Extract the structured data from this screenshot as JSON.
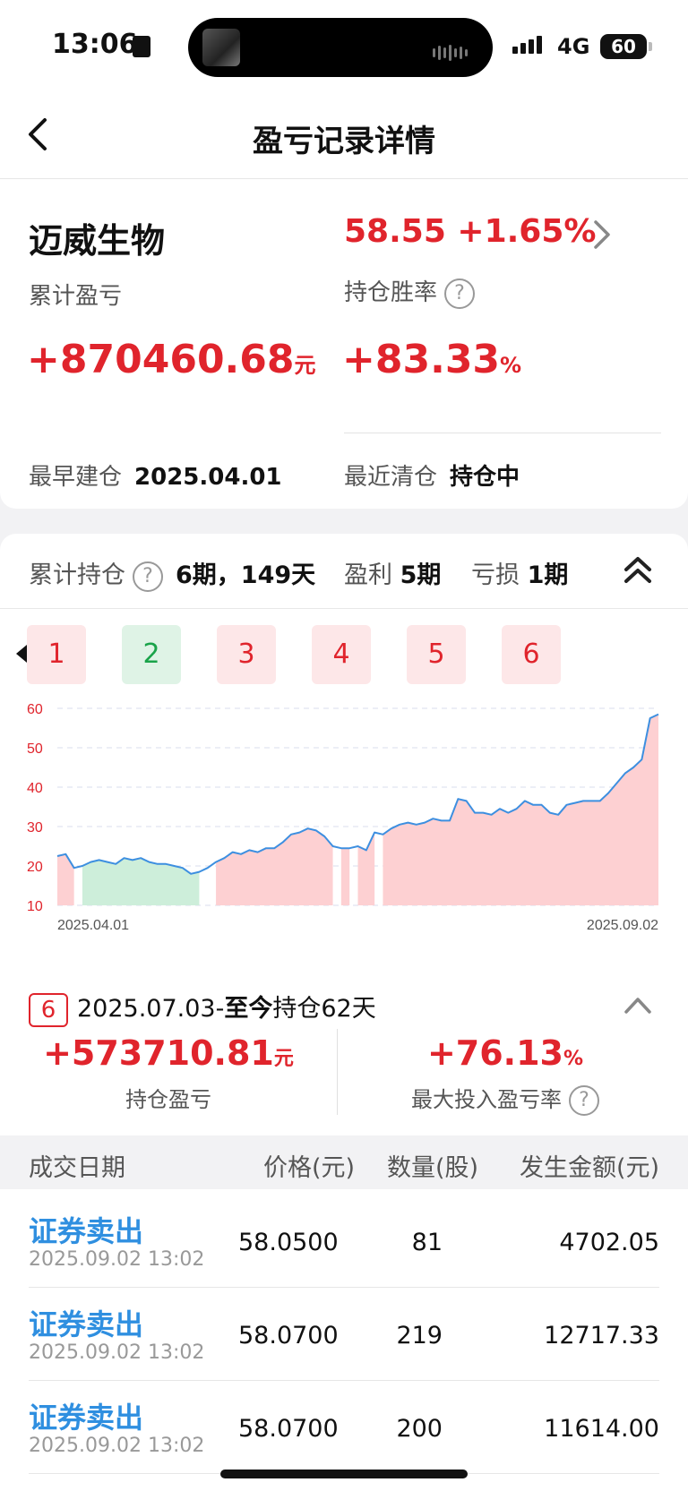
{
  "status_bar": {
    "time": "13:06",
    "network": "4G",
    "battery": "60"
  },
  "nav": {
    "title": "盈亏记录详情"
  },
  "stock": {
    "name": "迈威生物",
    "price_change": "58.55 +1.65%",
    "cumulative_label": "累计盈亏",
    "cumulative_value": "+870460.68",
    "cumulative_unit": "元",
    "winrate_label": "持仓胜率",
    "winrate_value": "+83.33",
    "winrate_unit": "%",
    "first_open_label": "最早建仓",
    "first_open_value": "2025.04.01",
    "last_clear_label": "最近清仓",
    "last_clear_value": "持仓中"
  },
  "holdings_summary": {
    "total_label": "累计持仓",
    "total_value": "6期，149天",
    "profit_label": "盈利",
    "profit_value": "5期",
    "loss_label": "亏损",
    "loss_value": "1期"
  },
  "periods": [
    {
      "label": "1",
      "result": "loss"
    },
    {
      "label": "2",
      "result": "win"
    },
    {
      "label": "3",
      "result": "loss"
    },
    {
      "label": "4",
      "result": "loss"
    },
    {
      "label": "5",
      "result": "loss"
    },
    {
      "label": "6",
      "result": "loss"
    }
  ],
  "chart_data": {
    "type": "area",
    "y_ticks": [
      "60",
      "50",
      "40",
      "30",
      "20",
      "10"
    ],
    "ylim": [
      10,
      60
    ],
    "x_start_label": "2025.04.01",
    "x_end_label": "2025.09.02",
    "grid": true,
    "colors": {
      "line": "#3d8fe0",
      "loss_fill": "#fdd0d2",
      "win_fill": "#cdeeda"
    },
    "price_series": [
      22.5,
      23,
      19.5,
      20,
      21,
      21.5,
      21,
      20.5,
      22,
      21.5,
      22,
      21,
      20.5,
      20.5,
      20,
      19.5,
      18,
      18.5,
      19.5,
      21,
      22,
      23.5,
      23,
      24,
      23.5,
      24.5,
      24.5,
      26,
      28,
      28.5,
      29.5,
      29,
      27.5,
      25,
      24.5,
      24.5,
      25,
      24,
      28.5,
      28,
      29.5,
      30.5,
      31,
      30.5,
      31,
      32,
      31.5,
      31.5,
      37,
      36.5,
      33.5,
      33.5,
      33,
      34.5,
      33.5,
      34.5,
      36.5,
      35.5,
      35.5,
      33.5,
      33,
      35.5,
      36,
      36.5,
      36.5,
      36.5,
      38.5,
      41,
      43.5,
      45,
      47,
      57.5,
      58.5
    ],
    "holding_segments": [
      {
        "period": "1",
        "result": "loss",
        "start": 0,
        "end": 2
      },
      {
        "period": "2",
        "result": "win",
        "start": 3,
        "end": 17
      },
      {
        "period": "3",
        "result": "loss",
        "start": 19,
        "end": 33
      },
      {
        "period": "4",
        "result": "loss",
        "start": 34,
        "end": 35
      },
      {
        "period": "5",
        "result": "loss",
        "start": 36,
        "end": 38
      },
      {
        "period": "6",
        "result": "loss",
        "start": 39,
        "end": 72
      }
    ]
  },
  "current_period": {
    "badge": "6",
    "date_range": "2025.07.03-",
    "to_now": "至今",
    "holding_prefix": "持仓",
    "days": "62天",
    "pnl_value": "+573710.81",
    "pnl_unit": "元",
    "pnl_label": "持仓盈亏",
    "rate_value": "+76.13",
    "rate_unit": "%",
    "rate_label": "最大投入盈亏率"
  },
  "table": {
    "headers": [
      "成交日期",
      "价格(元)",
      "数量(股)",
      "发生金额(元)"
    ],
    "rows": [
      {
        "type": "证券卖出",
        "time": "2025.09.02 13:02",
        "price": "58.0500",
        "qty": "81",
        "amount": "4702.05"
      },
      {
        "type": "证券卖出",
        "time": "2025.09.02 13:02",
        "price": "58.0700",
        "qty": "219",
        "amount": "12717.33"
      },
      {
        "type": "证券卖出",
        "time": "2025.09.02 13:02",
        "price": "58.0700",
        "qty": "200",
        "amount": "11614.00"
      }
    ]
  }
}
